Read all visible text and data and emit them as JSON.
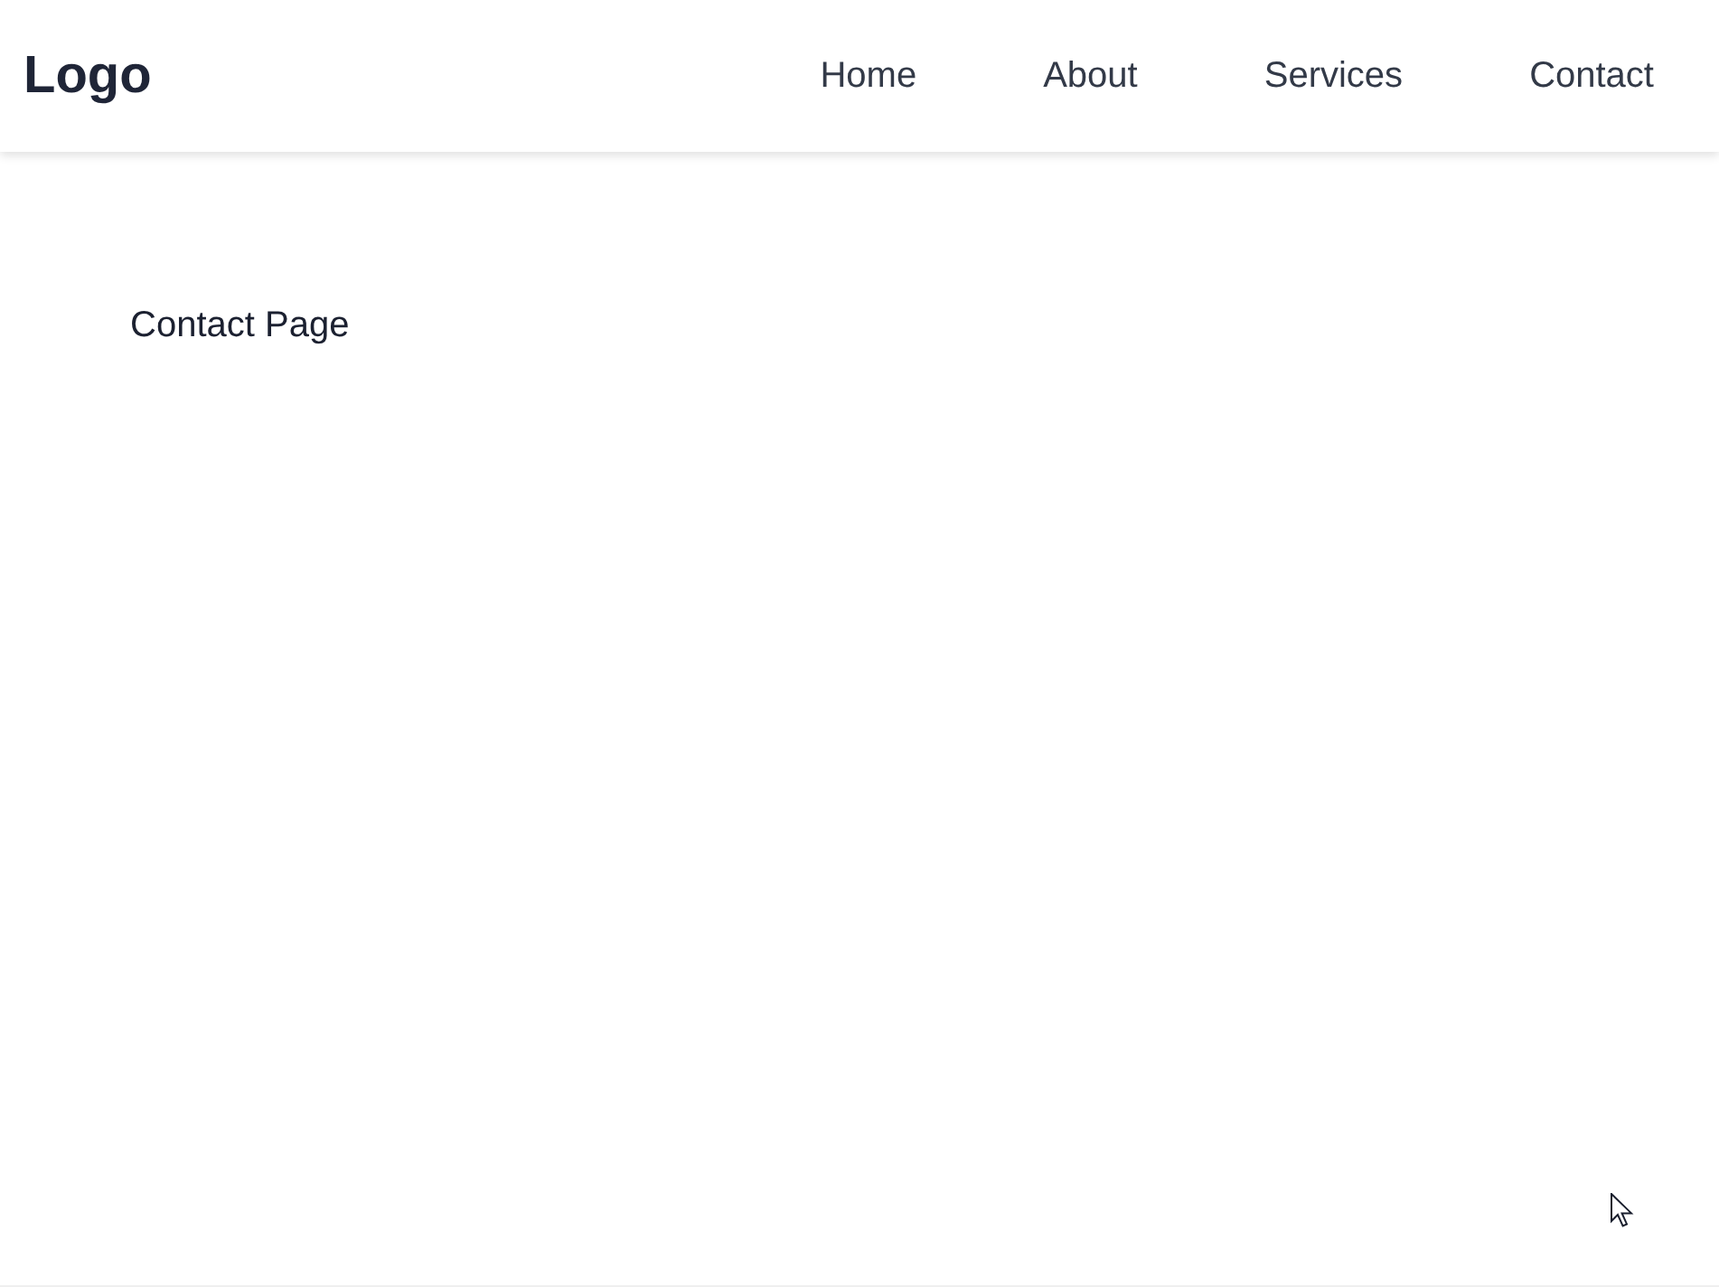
{
  "header": {
    "logo": "Logo",
    "nav": [
      {
        "label": "Home"
      },
      {
        "label": "About"
      },
      {
        "label": "Services"
      },
      {
        "label": "Contact"
      }
    ]
  },
  "main": {
    "heading": "Contact Page"
  }
}
